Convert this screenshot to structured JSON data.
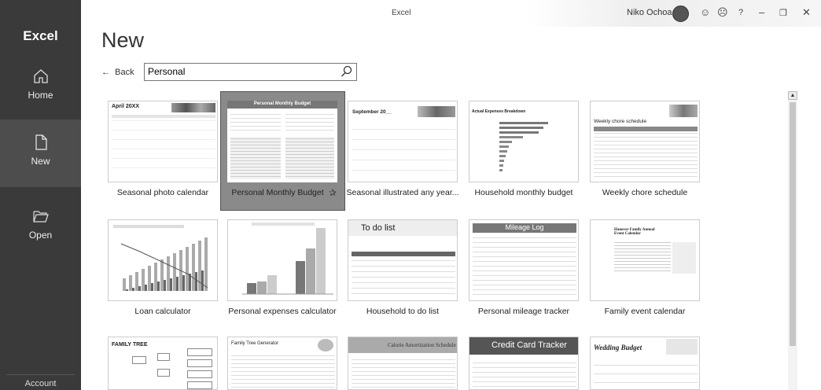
{
  "sidebar": {
    "app_name": "Excel",
    "items": [
      {
        "label": "Home"
      },
      {
        "label": "New"
      },
      {
        "label": "Open"
      }
    ],
    "account_label": "Account"
  },
  "titlebar": {
    "title": "Excel",
    "user_name": "Niko Ochoa",
    "help": "?"
  },
  "page": {
    "heading": "New",
    "back_label": "Back",
    "search_value": "Personal"
  },
  "templates": [
    {
      "label": "Seasonal photo calendar",
      "preview_title": "April 20XX"
    },
    {
      "label": "Personal Monthly Budget",
      "preview_title": "Personal Monthly Budget"
    },
    {
      "label": "Seasonal illustrated any year...",
      "preview_title": "September 20__"
    },
    {
      "label": "Household monthly budget",
      "preview_title": "Actual Expenses Breakdown"
    },
    {
      "label": "Weekly chore schedule",
      "preview_title": "Weekly chore schedule"
    },
    {
      "label": "Loan calculator",
      "preview_title": ""
    },
    {
      "label": "Personal expenses calculator",
      "preview_title": ""
    },
    {
      "label": "Household to do list",
      "preview_title": "To do list"
    },
    {
      "label": "Personal mileage tracker",
      "preview_title": "Mileage Log"
    },
    {
      "label": "Family event calendar",
      "preview_title": "Hanover Family Annual Event Calendar"
    },
    {
      "label": "",
      "preview_title": "FAMILY TREE"
    },
    {
      "label": "",
      "preview_title": "Family Tree Generator"
    },
    {
      "label": "",
      "preview_title": "Calorie Amortization Schedule"
    },
    {
      "label": "",
      "preview_title": "Credit Card Tracker"
    },
    {
      "label": "",
      "preview_title": "Wedding Budget"
    }
  ]
}
